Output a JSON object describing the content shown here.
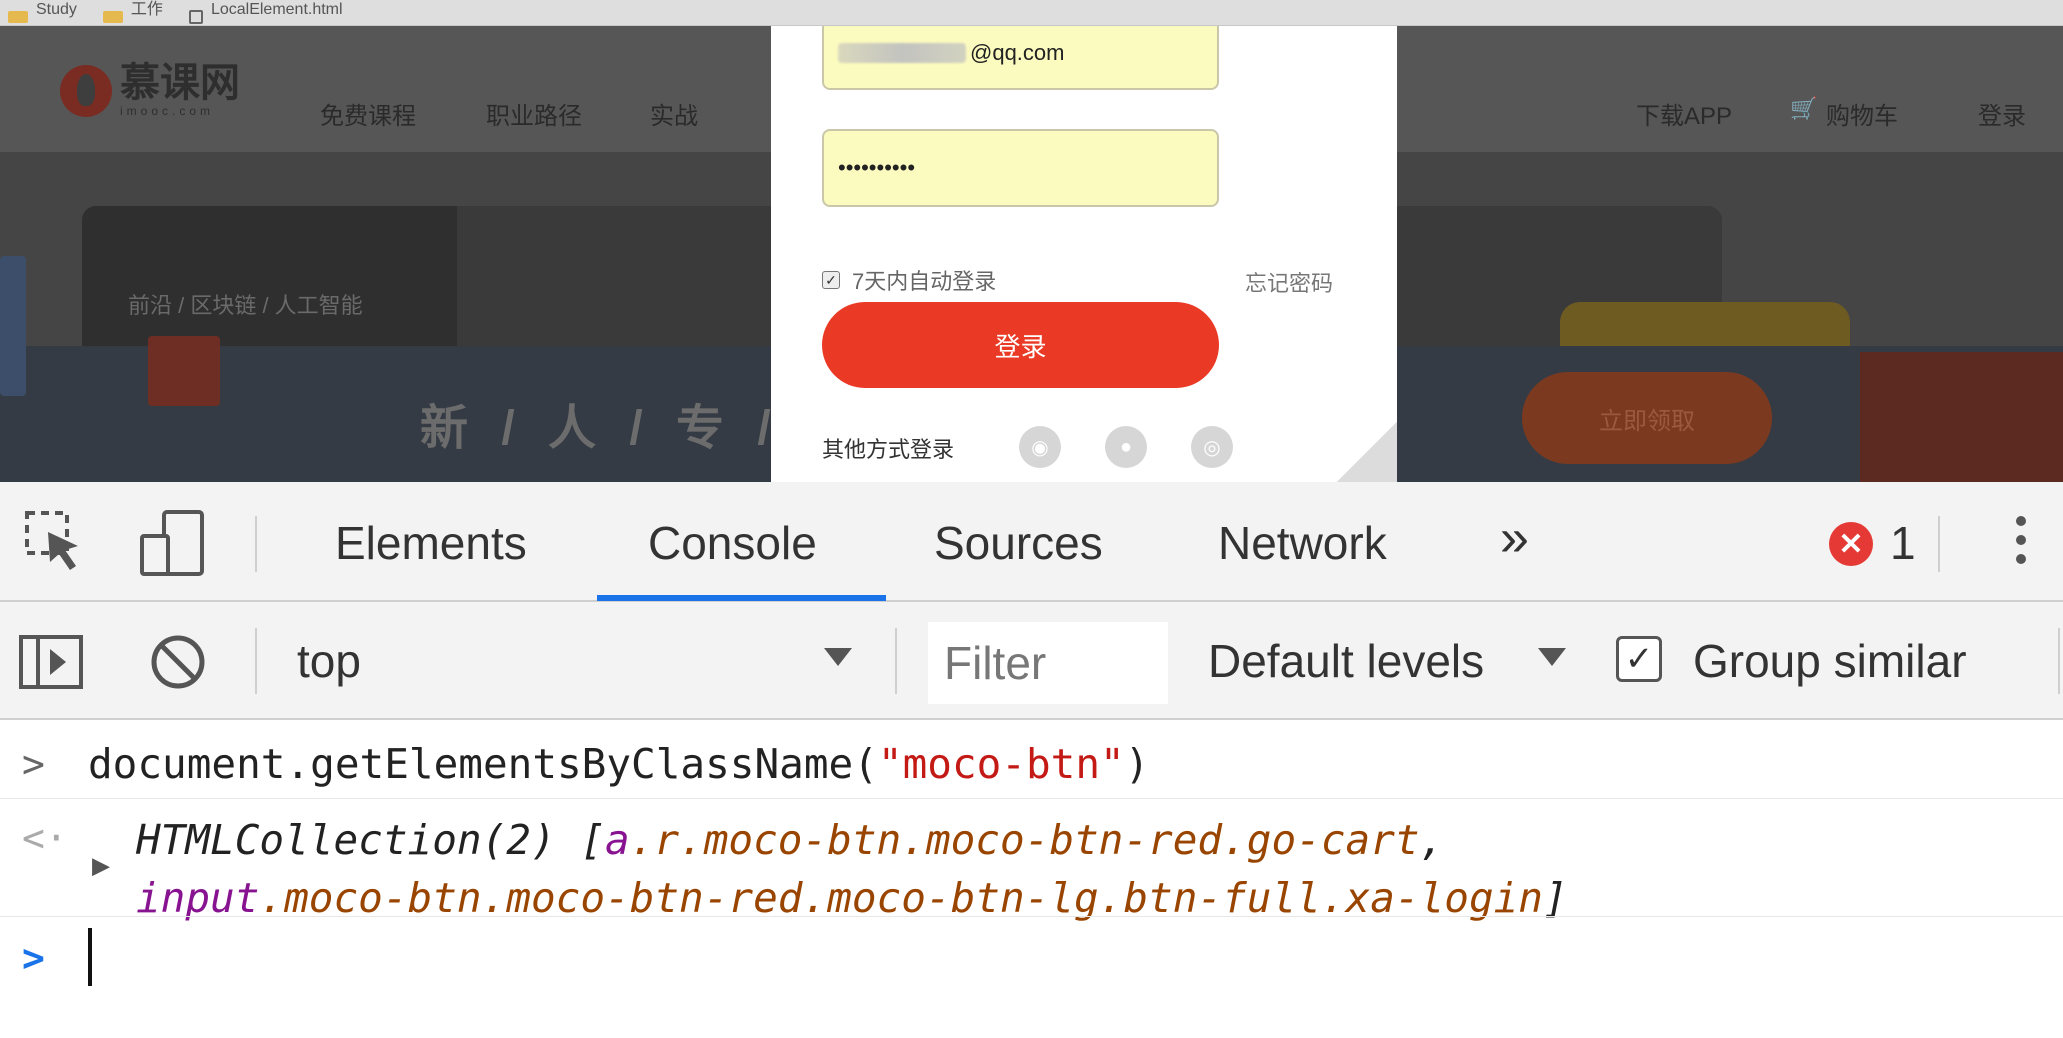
{
  "bookmarks": [
    {
      "label": "Study",
      "icon": "folder-icon"
    },
    {
      "label": "工作",
      "icon": "folder-icon"
    },
    {
      "label": "LocalElement.html",
      "icon": "page-icon"
    }
  ],
  "site": {
    "logo_text": "慕课网",
    "logo_sub": "imooc.com",
    "nav": [
      "免费课程",
      "职业路径",
      "实战"
    ],
    "right_links": [
      "下载APP",
      "购物车",
      "登录"
    ],
    "banner_category": "前沿 / 区块链 / 人工智能",
    "banner_slogan": "新 / 人 / 专 / 享",
    "banner_button": "立即领取"
  },
  "login_modal": {
    "email_suffix": "@qq.com",
    "password_mask": "••••••••••",
    "remember_label": "7天内自动登录",
    "forgot_label": "忘记密码",
    "login_button": "登录",
    "other_login_label": "其他方式登录",
    "social_icons": [
      "qq-icon",
      "wechat-icon",
      "weibo-icon"
    ]
  },
  "devtools": {
    "tabs": [
      "Elements",
      "Console",
      "Sources",
      "Network"
    ],
    "active_tab": "Console",
    "more_tabs": "»",
    "error_count": "1",
    "error_icon": "✕",
    "toolbar": {
      "context": "top",
      "filter_placeholder": "Filter",
      "levels": "Default levels",
      "group_similar": "Group similar"
    },
    "console": {
      "input_prefix": "document.getElementsByClassName(",
      "input_string": "\"moco-btn\"",
      "input_suffix": ")",
      "result_head": "HTMLCollection(2) [",
      "item1_tag": "a",
      "item1_classes": ".r.moco-btn.moco-btn-red.go-cart",
      "item1_comma": ",",
      "item2_tag": "input",
      "item2_classes": ".moco-btn.moco-btn-red.moco-btn-lg.btn-full.xa-login",
      "result_tail": "]"
    },
    "colors": {
      "active_underline": "#1a73e8",
      "error": "#e53935",
      "string": "#c41a16",
      "tag": "#881391",
      "attr": "#994500"
    }
  }
}
